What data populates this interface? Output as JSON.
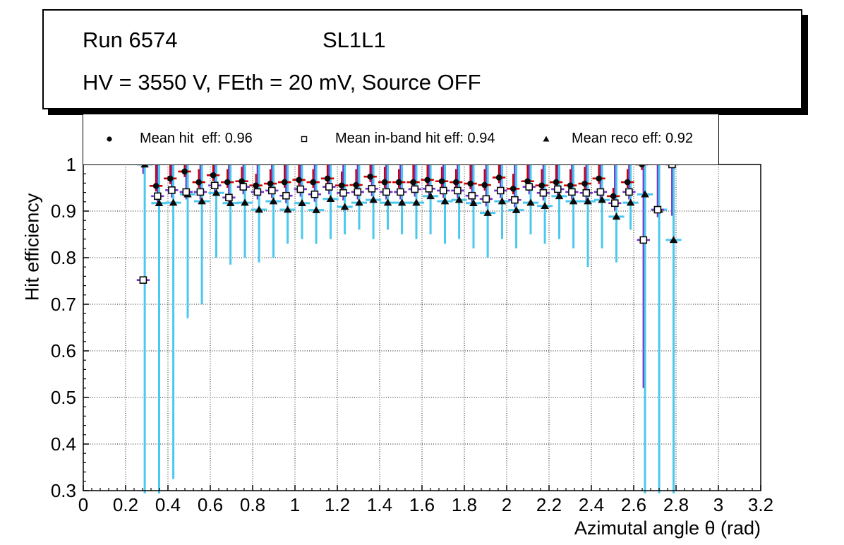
{
  "title_box": {
    "line1_left": "Run 6574",
    "line1_right": "SL1L1",
    "line2": "HV = 3550 V, FEth = 20 mV, Source OFF"
  },
  "legend": {
    "entries": [
      {
        "marker": "filled-circle",
        "label": "Mean hit  eff: 0.96"
      },
      {
        "marker": "open-square",
        "label": "Mean in-band hit eff: 0.94"
      },
      {
        "marker": "filled-triangle",
        "label": "Mean reco eff: 0.92"
      }
    ]
  },
  "axes": {
    "x_label": "Azimutal angle θ (rad)",
    "y_label": "Hit efficiency",
    "x_minor_step": 0.04,
    "y_minor_step": 0.02
  },
  "colors": {
    "hit_err": "#cc0000",
    "inband_err": "#7130c6",
    "reco_err": "#4ac8ee",
    "marker": "#0a0a0a",
    "grid": "#111111"
  },
  "chart_data": {
    "type": "scatter",
    "title": "Run 6574  SL1L1",
    "subtitle": "HV = 3550 V, FEth = 20 mV, Source OFF",
    "xlabel": "Azimutal angle θ (rad)",
    "ylabel": "Hit efficiency",
    "xlim": [
      0,
      3.2
    ],
    "ylim": [
      0.3,
      1.0
    ],
    "grid": "dotted",
    "legend_position": "top",
    "x_tick_values": [
      0,
      0.2,
      0.4,
      0.6,
      0.8,
      1,
      1.2,
      1.4,
      1.6,
      1.8,
      2,
      2.2,
      2.4,
      2.6,
      2.8,
      3,
      3.2
    ],
    "x_tick_labels": [
      "0",
      "0.2",
      "0.4",
      "0.6",
      "0.8",
      "1",
      "1.2",
      "1.4",
      "1.6",
      "1.8",
      "2",
      "2.2",
      "2.4",
      "2.6",
      "2.8",
      "3",
      "3.2"
    ],
    "y_tick_values": [
      0.3,
      0.4,
      0.5,
      0.6,
      0.7,
      0.8,
      0.9,
      1
    ],
    "y_tick_labels": [
      "0.3",
      "0.4",
      "0.5",
      "0.6",
      "0.7",
      "0.8",
      "0.9",
      "1"
    ],
    "series": [
      {
        "name": "Mean hit eff",
        "mean": 0.96,
        "marker": "filled-circle",
        "err_color": "#cc0000"
      },
      {
        "name": "Mean in-band hit eff",
        "mean": 0.94,
        "marker": "open-square",
        "err_color": "#7130c6"
      },
      {
        "name": "Mean reco eff",
        "mean": 0.92,
        "marker": "filled-triangle",
        "err_color": "#4ac8ee"
      }
    ],
    "xerr": 0.0305,
    "xerr_cyan": 0.037,
    "red_lo_delta": 0.012,
    "points": {
      "theta": [
        0.283,
        0.351,
        0.418,
        0.486,
        0.553,
        0.621,
        0.688,
        0.756,
        0.823,
        0.891,
        0.958,
        1.026,
        1.093,
        1.161,
        1.228,
        1.296,
        1.363,
        1.431,
        1.498,
        1.566,
        1.633,
        1.701,
        1.768,
        1.836,
        1.903,
        1.971,
        2.038,
        2.106,
        2.173,
        2.241,
        2.308,
        2.376,
        2.443,
        2.511,
        2.578,
        2.646,
        2.713,
        2.781
      ],
      "hit": [
        null,
        0.954,
        0.97,
        0.985,
        0.962,
        0.977,
        0.962,
        0.964,
        0.955,
        0.959,
        0.962,
        0.967,
        0.962,
        0.97,
        0.955,
        0.956,
        0.974,
        0.962,
        0.962,
        0.962,
        0.967,
        0.964,
        0.962,
        0.959,
        0.956,
        0.972,
        0.948,
        0.964,
        0.955,
        0.962,
        0.955,
        0.959,
        0.97,
        0.932,
        0.962,
        1.0,
        null,
        null
      ],
      "inband": [
        0.752,
        0.932,
        0.945,
        0.941,
        0.941,
        0.955,
        0.929,
        0.952,
        0.941,
        0.944,
        0.933,
        0.947,
        0.936,
        0.952,
        0.939,
        0.941,
        0.948,
        0.941,
        0.941,
        0.947,
        0.948,
        0.944,
        0.944,
        0.933,
        0.926,
        0.944,
        0.924,
        0.952,
        0.939,
        0.947,
        0.941,
        0.939,
        0.941,
        0.917,
        0.941,
        0.838,
        0.903,
        1.0
      ],
      "reco": [
        1.0,
        0.917,
        0.918,
        0.936,
        0.921,
        0.939,
        0.917,
        0.918,
        0.903,
        0.921,
        0.903,
        0.917,
        0.902,
        0.926,
        0.909,
        0.918,
        0.924,
        0.918,
        0.918,
        0.918,
        0.932,
        0.921,
        0.924,
        0.917,
        0.896,
        0.921,
        0.902,
        0.918,
        0.911,
        0.932,
        0.921,
        0.921,
        0.924,
        0.888,
        0.918,
        0.936,
        0.903,
        0.838
      ],
      "cyan_lo": [
        0.28,
        0.305,
        0.325,
        0.67,
        0.7,
        0.8,
        0.785,
        0.8,
        0.79,
        0.8,
        0.83,
        0.84,
        0.83,
        0.84,
        0.85,
        0.86,
        0.84,
        0.86,
        0.85,
        0.84,
        0.85,
        0.83,
        0.84,
        0.82,
        0.8,
        0.84,
        0.82,
        0.85,
        0.83,
        0.84,
        0.82,
        0.78,
        0.82,
        0.79,
        0.86,
        0.28,
        0.28,
        0.28
      ],
      "purple_lo": [
        0.98,
        0.916,
        0.929,
        0.925,
        0.925,
        0.939,
        0.913,
        0.936,
        0.925,
        0.928,
        0.917,
        0.931,
        0.92,
        0.936,
        0.923,
        0.925,
        0.932,
        0.925,
        0.925,
        0.931,
        0.932,
        0.928,
        0.928,
        0.917,
        0.91,
        0.928,
        0.908,
        0.936,
        0.923,
        0.931,
        0.925,
        0.923,
        0.925,
        0.901,
        0.925,
        0.52,
        0.887,
        0.89
      ],
      "red_hi": [
        null,
        1.0,
        1.0,
        1.0,
        0.99,
        1.0,
        0.99,
        0.995,
        0.98,
        0.99,
        1.0,
        1.0,
        0.99,
        1.0,
        0.985,
        0.99,
        1.0,
        0.995,
        0.99,
        1.0,
        1.0,
        0.995,
        0.99,
        1.0,
        0.99,
        1.0,
        0.98,
        1.0,
        0.99,
        1.0,
        0.99,
        0.995,
        1.0,
        0.95,
        0.99,
        1.0,
        null,
        null
      ]
    }
  }
}
